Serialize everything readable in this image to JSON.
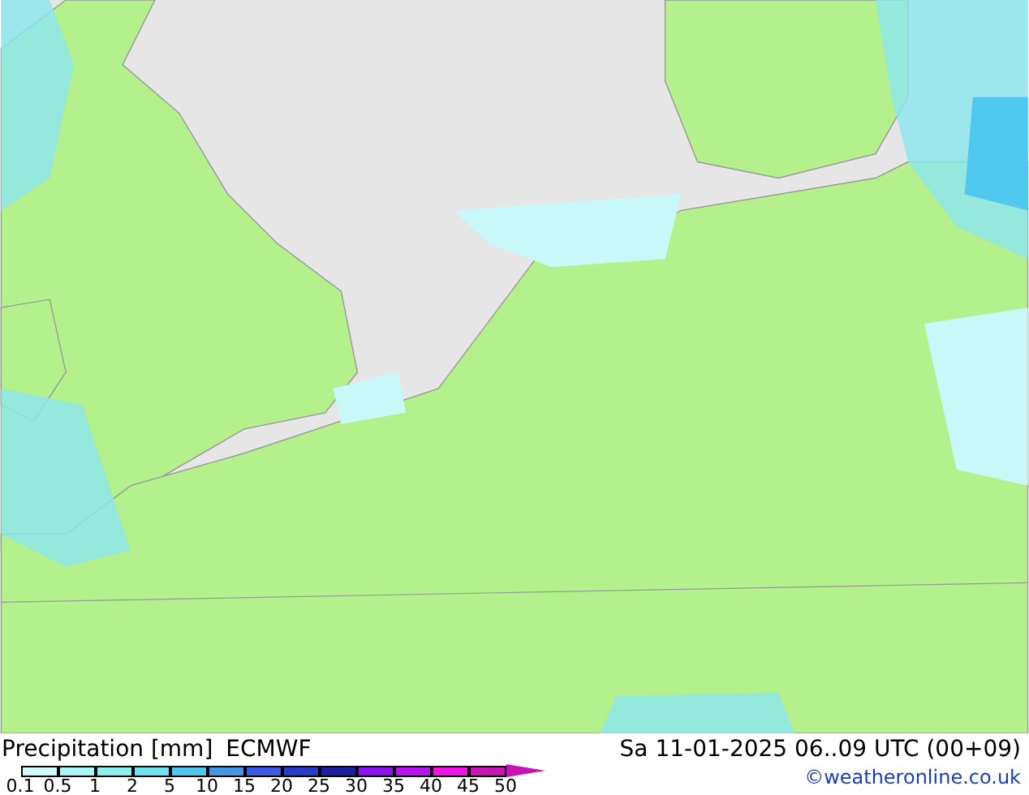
{
  "legend": {
    "title": "Precipitation [mm]",
    "model": "ECMWF",
    "valid_time": "Sa 11-01-2025 06..09 UTC (00+09)",
    "credit": "©weatheronline.co.uk",
    "colors": [
      {
        "color": "#d2fafa"
      },
      {
        "color": "#aaf5f5"
      },
      {
        "color": "#8cf0f0"
      },
      {
        "color": "#6ee1ee"
      },
      {
        "color": "#50c8f0"
      },
      {
        "color": "#4696e6"
      },
      {
        "color": "#3c5ae6"
      },
      {
        "color": "#283cc8"
      },
      {
        "color": "#1e1ea0"
      },
      {
        "color": "#8c14f0"
      },
      {
        "color": "#b414f0"
      },
      {
        "color": "#f014e6"
      },
      {
        "color": "#c814b4"
      }
    ],
    "ticks": [
      "0.1",
      "0.5",
      "1",
      "2",
      "5",
      "10",
      "15",
      "20",
      "25",
      "30",
      "35",
      "40",
      "45",
      "50"
    ]
  }
}
